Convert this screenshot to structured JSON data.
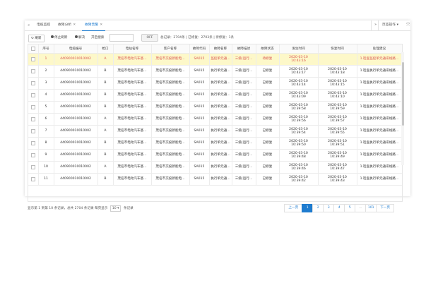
{
  "tabs": [
    {
      "label": "电缆监控",
      "active": false,
      "closable": false
    },
    {
      "label": "故障分析",
      "active": false,
      "closable": true
    },
    {
      "label": "故障告警",
      "active": true,
      "closable": true
    }
  ],
  "tab_ops_label": "页签操作",
  "toolbar": {
    "refresh_label": "刷新",
    "stop_refresh_label": "停止刷新",
    "resolved_label": "解决",
    "open_search_label": "开启搜索",
    "toggle_label": "OFF",
    "summary": "总记录：2704条 | 已修复：2703条 | 待修复：1条"
  },
  "table": {
    "columns": [
      "",
      "序号",
      "电缆编号",
      "枪口",
      "电站名称",
      "客户名称",
      "故障代码",
      "故障名称",
      "故障描述",
      "故障状态",
      "发生时间",
      "恢复时间",
      "处理建议"
    ],
    "rows": [
      {
        "no": "1",
        "cable": "440900010010002",
        "port": "A",
        "station": "茂名市电动汽车基...",
        "customer": "茂名市交投新能电...",
        "code": "SA015",
        "name": "监控单元通...",
        "desc": "三级(运行...",
        "status": "待修复",
        "occur": "2020-03-10\n10:43:16",
        "recover": "",
        "advice": "1.检查监控单元通讯线路..."
      },
      {
        "no": "2",
        "cable": "440900010010002",
        "port": "B",
        "station": "茂名市电动汽车基...",
        "customer": "茂名市交投新能电...",
        "code": "SA015",
        "name": "执行单元通...",
        "desc": "三级(运行...",
        "status": "已修复",
        "occur": "2020-03-10\n10:43:17",
        "recover": "2020-03-10\n10:43:18",
        "advice": "1.检查执行单元通讯线路..."
      },
      {
        "no": "3",
        "cable": "440900010010002",
        "port": "B",
        "station": "茂名市电动汽车基...",
        "customer": "茂名市交投新能电...",
        "code": "SA015",
        "name": "执行单元通...",
        "desc": "三级(运行...",
        "status": "已修复",
        "occur": "2020-03-10\n10:43:14",
        "recover": "2020-03-10\n10:43:15",
        "advice": "1.检查执行单元通讯线路..."
      },
      {
        "no": "4",
        "cable": "440900010010002",
        "port": "B",
        "station": "茂名市电动汽车基...",
        "customer": "茂名市交投新能电...",
        "code": "SA015",
        "name": "执行单元通...",
        "desc": "三级(运行...",
        "status": "已修复",
        "occur": "2020-03-10\n10:43:09",
        "recover": "2020-03-10\n10:43:10",
        "advice": "1.检查执行单元通讯线路..."
      },
      {
        "no": "5",
        "cable": "440900010010002",
        "port": "B",
        "station": "茂名市电动汽车基...",
        "customer": "茂名市交投新能电...",
        "code": "SA015",
        "name": "执行单元通...",
        "desc": "三级(运行...",
        "status": "已修复",
        "occur": "2020-03-10\n10:39:58",
        "recover": "2020-03-10\n10:39:59",
        "advice": "1.检查执行单元通讯线路..."
      },
      {
        "no": "6",
        "cable": "440900010010002",
        "port": "A",
        "station": "茂名市电动汽车基...",
        "customer": "茂名市交投新能电...",
        "code": "SA015",
        "name": "执行单元通...",
        "desc": "三级(运行...",
        "status": "已修复",
        "occur": "2020-03-10\n10:39:56",
        "recover": "2020-03-10\n10:39:57",
        "advice": "1.检查执行单元通讯线路..."
      },
      {
        "no": "7",
        "cable": "440900010010002",
        "port": "A",
        "station": "茂名市电动汽车基...",
        "customer": "茂名市交投新能电...",
        "code": "SA015",
        "name": "执行单元通...",
        "desc": "三级(运行...",
        "status": "已修复",
        "occur": "2020-03-10\n10:39:54",
        "recover": "2020-03-10\n10:39:55",
        "advice": "1.检查执行单元通讯线路..."
      },
      {
        "no": "8",
        "cable": "440900010010002",
        "port": "B",
        "station": "茂名市电动汽车基...",
        "customer": "茂名市交投新能电...",
        "code": "SA015",
        "name": "执行单元通...",
        "desc": "三级(运行...",
        "status": "已修复",
        "occur": "2020-03-10\n10:39:50",
        "recover": "2020-03-10\n10:39:51",
        "advice": "1.检查执行单元通讯线路..."
      },
      {
        "no": "9",
        "cable": "440900010010002",
        "port": "B",
        "station": "茂名市电动汽车基...",
        "customer": "茂名市交投新能电...",
        "code": "SA015",
        "name": "执行单元通...",
        "desc": "三级(运行...",
        "status": "已修复",
        "occur": "2020-03-10\n10:39:48",
        "recover": "2020-03-10\n10:39:49",
        "advice": "1.检查执行单元通讯线路..."
      },
      {
        "no": "10",
        "cable": "440900010010002",
        "port": "A",
        "station": "茂名市电动汽车基...",
        "customer": "茂名市交投新能电...",
        "code": "SA015",
        "name": "执行单元通...",
        "desc": "三级(运行...",
        "status": "已修复",
        "occur": "2020-03-10\n10:39:46",
        "recover": "2020-03-10\n10:39:47",
        "advice": "1.检查执行单元通讯线路..."
      },
      {
        "no": "11",
        "cable": "440900010010002",
        "port": "B",
        "station": "茂名市电动汽车基...",
        "customer": "茂名市交投新能电...",
        "code": "SA015",
        "name": "执行单元通...",
        "desc": "三级(运行...",
        "status": "已修复",
        "occur": "2020-03-10\n10:39:42",
        "recover": "2020-03-10\n10:39:43",
        "advice": "1.检查执行单元通讯线路..."
      }
    ]
  },
  "footer": {
    "info_prefix": "显示第 1 到第 10 条记录，总共 2704 条记录 每页显示",
    "page_size": "10",
    "info_suffix": "条记录",
    "pages": [
      "上一页",
      "1",
      "2",
      "3",
      "4",
      "5",
      "...",
      "101",
      "下一页"
    ],
    "active_page": "1"
  },
  "colors": {
    "accent": "#1f7ccf",
    "highlight_row": "#fdf8c9",
    "alert_text": "#d9534f"
  }
}
